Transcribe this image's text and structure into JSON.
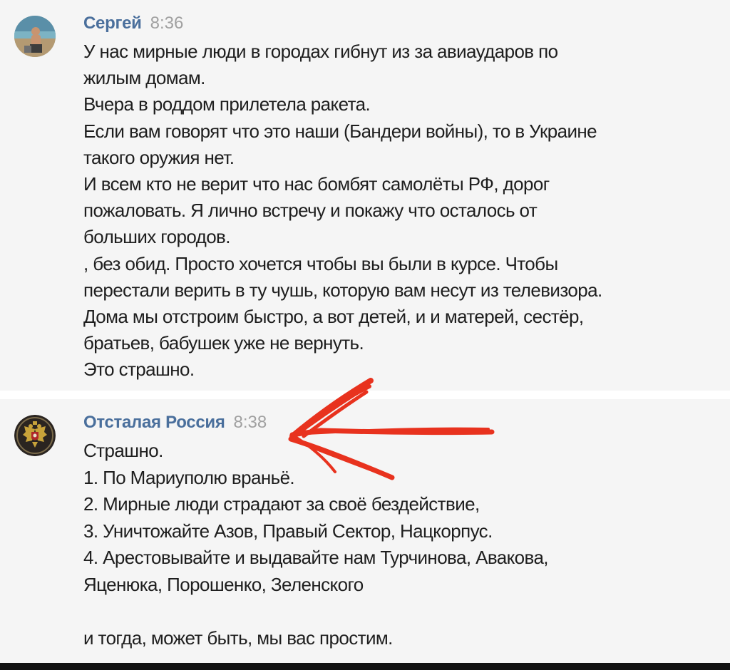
{
  "messages": [
    {
      "author": "Сергей",
      "time": "8:36",
      "lines": [
        "У нас мирные люди в городах гибнут из за авиаударов по",
        "жилым домам.",
        "Вчера в роддом прилетела ракета.",
        "Если вам говорят что это наши (Бандери войны), то в Украине",
        "такого оружия нет.",
        "И всем кто не верит что нас бомбят самолёты РФ, дорог",
        "пожаловать. Я лично встречу и покажу что осталось от",
        "больших городов.",
        ", без обид. Просто хочется чтобы вы были в курсе. Чтобы",
        "перестали верить в ту чушь, которую вам несут из телевизора.",
        "Дома мы отстроим быстро, а вот детей, и и матерей, сестёр,",
        "братьев, бабушек уже не вернуть.",
        "Это страшно."
      ]
    },
    {
      "author": "Отсталая Россия",
      "time": "8:38",
      "lines": [
        "Страшно.",
        "1. По Мариуполю враньё.",
        "2. Мирные люди страдают за своё бездействие,",
        "3. Уничтожайте Азов, Правый Сектор, Нацкорпус.",
        "4. Арестовывайте и выдавайте нам Турчинова, Авакова,",
        "Яценюка, Порошенко, Зеленского",
        "",
        "и тогда, может быть, мы вас простим."
      ]
    }
  ],
  "colors": {
    "author": "#4a6f9c",
    "time": "#a0a0a0",
    "annotation_arrow": "#e8321e",
    "background": "#f5f5f5"
  },
  "icons": {
    "avatar_1": "person-photo-avatar",
    "avatar_2": "double-headed-eagle-emblem-avatar",
    "annotation": "red-arrow-icon"
  }
}
